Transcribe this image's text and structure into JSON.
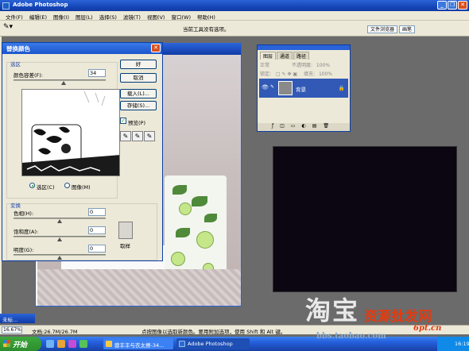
{
  "app": {
    "title": "Adobe Photoshop"
  },
  "menu": [
    "文件(F)",
    "编辑(E)",
    "图像(I)",
    "图层(L)",
    "选择(S)",
    "滤镜(T)",
    "视图(V)",
    "窗口(W)",
    "帮助(H)"
  ],
  "options": {
    "message": "当前工具没有选项。",
    "wells": [
      "文件浏览器",
      "画笔"
    ]
  },
  "dialog": {
    "title": "替换颜色",
    "selection_group": "选区",
    "fuzziness_label": "颜色容差(F):",
    "fuzziness_value": "34",
    "fuzziness_level": 0.17,
    "radio_selection": "选区(C)",
    "radio_image": "图像(M)",
    "transform_group": "变换",
    "hue_label": "色相(H):",
    "hue_value": "0",
    "saturation_label": "饱和度(A):",
    "saturation_value": "0",
    "lightness_label": "明度(G):",
    "lightness_value": "0",
    "swatch_label": "取样",
    "buttons": {
      "ok": "好",
      "cancel": "取消",
      "load": "载入(L)...",
      "save": "存储(S)..."
    },
    "preview_label": "预览(P)",
    "preview_checked": true
  },
  "layers": {
    "tabs": [
      "图层",
      "通道",
      "路径"
    ],
    "blend_mode": "正常",
    "opacity_label": "不透明度:",
    "opacity_value": "100%",
    "lock_label": "锁定:",
    "fill_label": "填充:",
    "fill_value": "100%",
    "layer_name": "背景"
  },
  "status": {
    "zoom": "16.67%",
    "doc": "文档:26.7M/26.7M",
    "tip": "点按图像以选取新颜色。要用附加选项，使用 Shift 和 Alt 键。"
  },
  "minimized_window": "未标...",
  "watermarks": {
    "taobao": "淘宝",
    "site": "资源批发网",
    "url": "bbs.taobao.com",
    "six_pt": "6pt.cn"
  },
  "taskbar": {
    "start": "开始",
    "items": [
      "蓉丰丰与衣太擦-34...",
      "Adobe Photoshop"
    ],
    "clock": "16:19"
  }
}
